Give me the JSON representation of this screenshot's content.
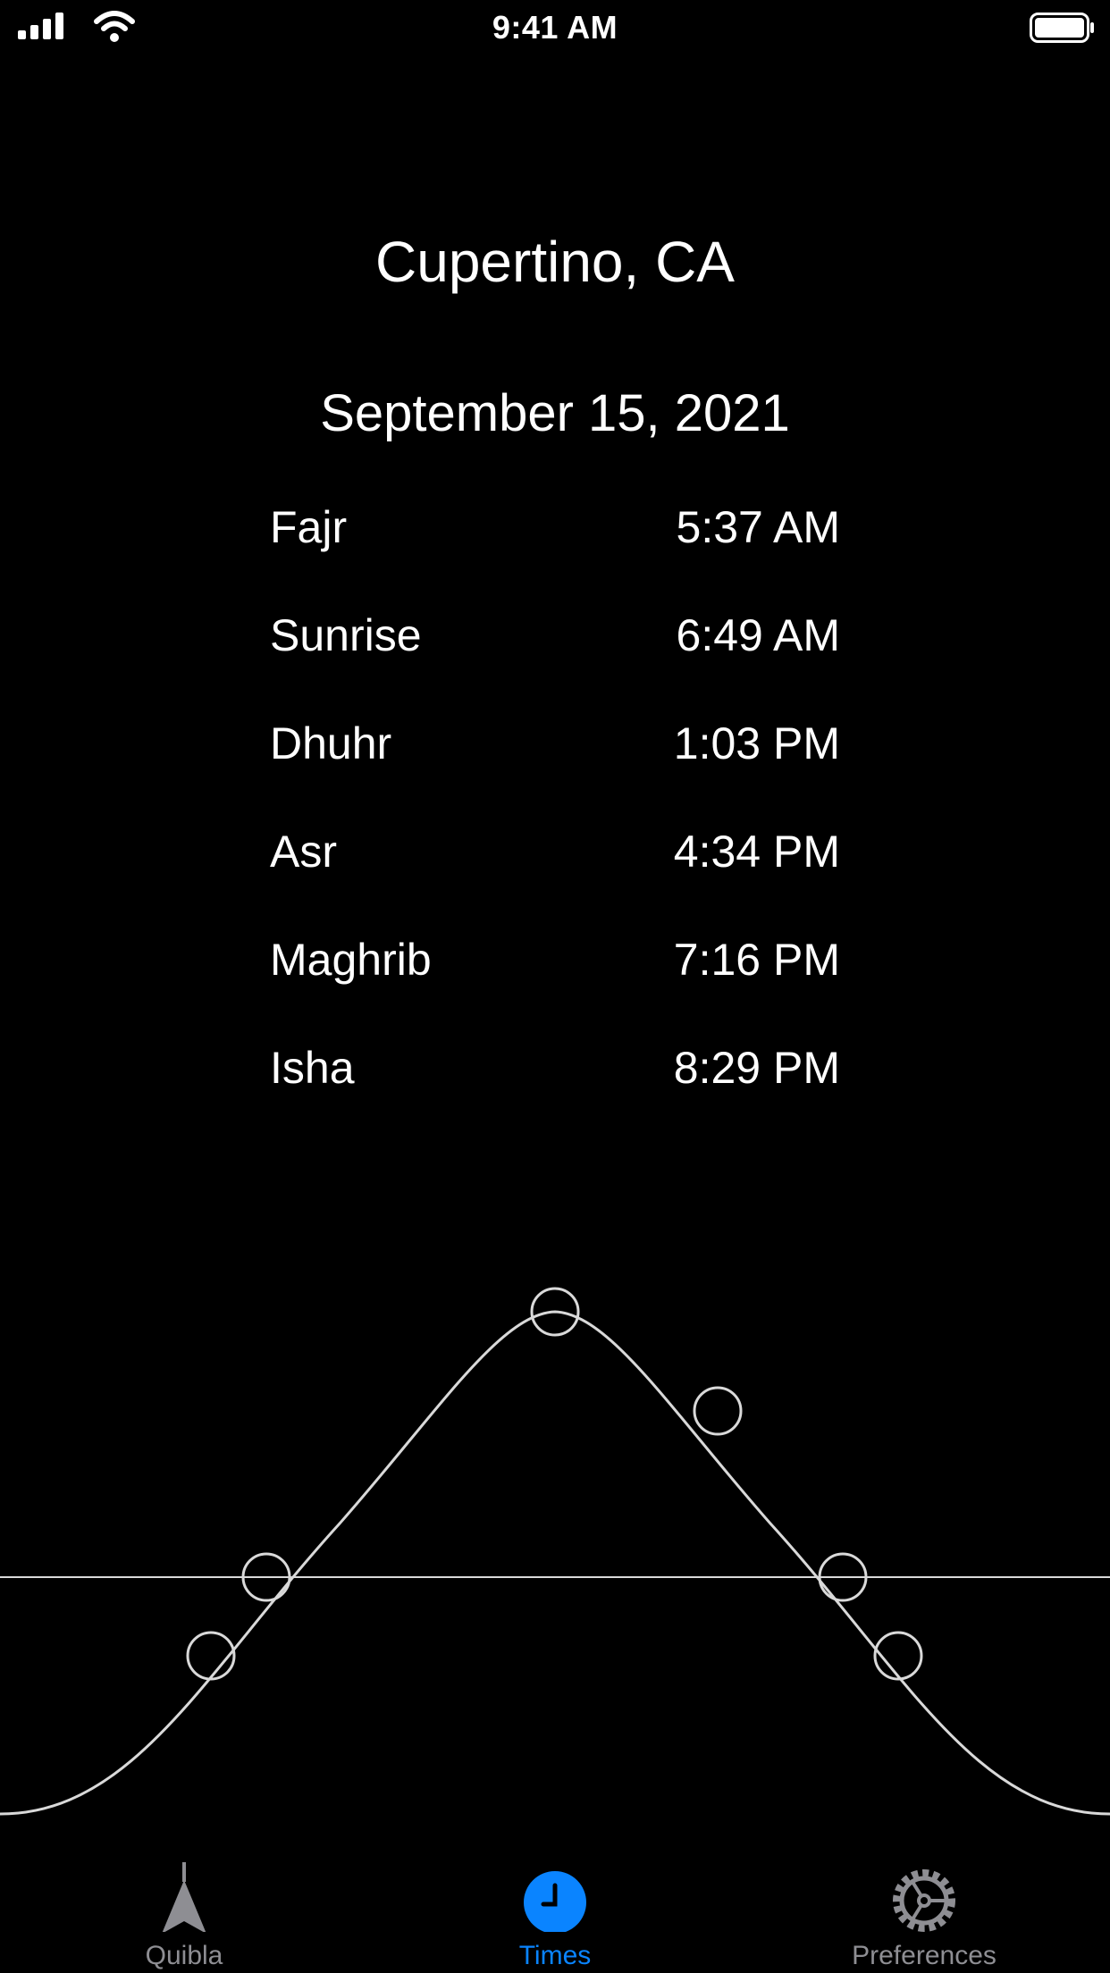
{
  "status_bar": {
    "time": "9:41 AM"
  },
  "header": {
    "location": "Cupertino, CA",
    "date": "September 15, 2021"
  },
  "prayer_times": [
    {
      "name": "Fajr",
      "time": "5:37 AM"
    },
    {
      "name": "Sunrise",
      "time": "6:49 AM"
    },
    {
      "name": "Dhuhr",
      "time": "1:03 PM"
    },
    {
      "name": "Asr",
      "time": "4:34 PM"
    },
    {
      "name": "Maghrib",
      "time": "7:16 PM"
    },
    {
      "name": "Isha",
      "time": "8:29 PM"
    }
  ],
  "tab_bar": {
    "tabs": [
      {
        "label": "Quibla",
        "icon": "compass-arrow-icon",
        "selected": false
      },
      {
        "label": "Times",
        "icon": "clock-icon",
        "selected": true
      },
      {
        "label": "Preferences",
        "icon": "gear-icon",
        "selected": false
      }
    ]
  },
  "colors": {
    "background": "#000000",
    "text": "#ffffff",
    "accent": "#0a84ff",
    "inactive": "#8e8e93",
    "curve": "#d9d9d9"
  }
}
